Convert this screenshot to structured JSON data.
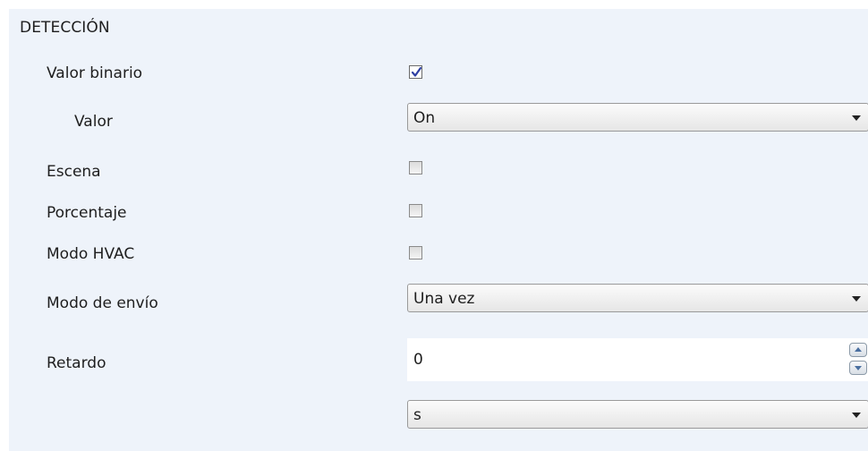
{
  "section": {
    "title": "DETECCIÓN"
  },
  "rows": {
    "valor_binario": {
      "label": "Valor binario",
      "checked": true
    },
    "valor": {
      "label": "Valor",
      "selected": "On"
    },
    "escena": {
      "label": "Escena",
      "checked": false
    },
    "porcentaje": {
      "label": "Porcentaje",
      "checked": false
    },
    "modo_hvac": {
      "label": "Modo HVAC",
      "checked": false
    },
    "modo_envio": {
      "label": "Modo de envío",
      "selected": "Una vez"
    },
    "retardo": {
      "label": "Retardo",
      "value": "0",
      "unit_selected": "s"
    }
  },
  "icons": {
    "checkmark": "check-icon",
    "dropdown": "chevron-down-icon",
    "spin_up": "arrow-up-icon",
    "spin_down": "arrow-down-icon"
  },
  "colors": {
    "panel_background": "#eef3fa",
    "checkmark": "#2e3fa3",
    "spin_arrow": "#4a6fa0"
  }
}
